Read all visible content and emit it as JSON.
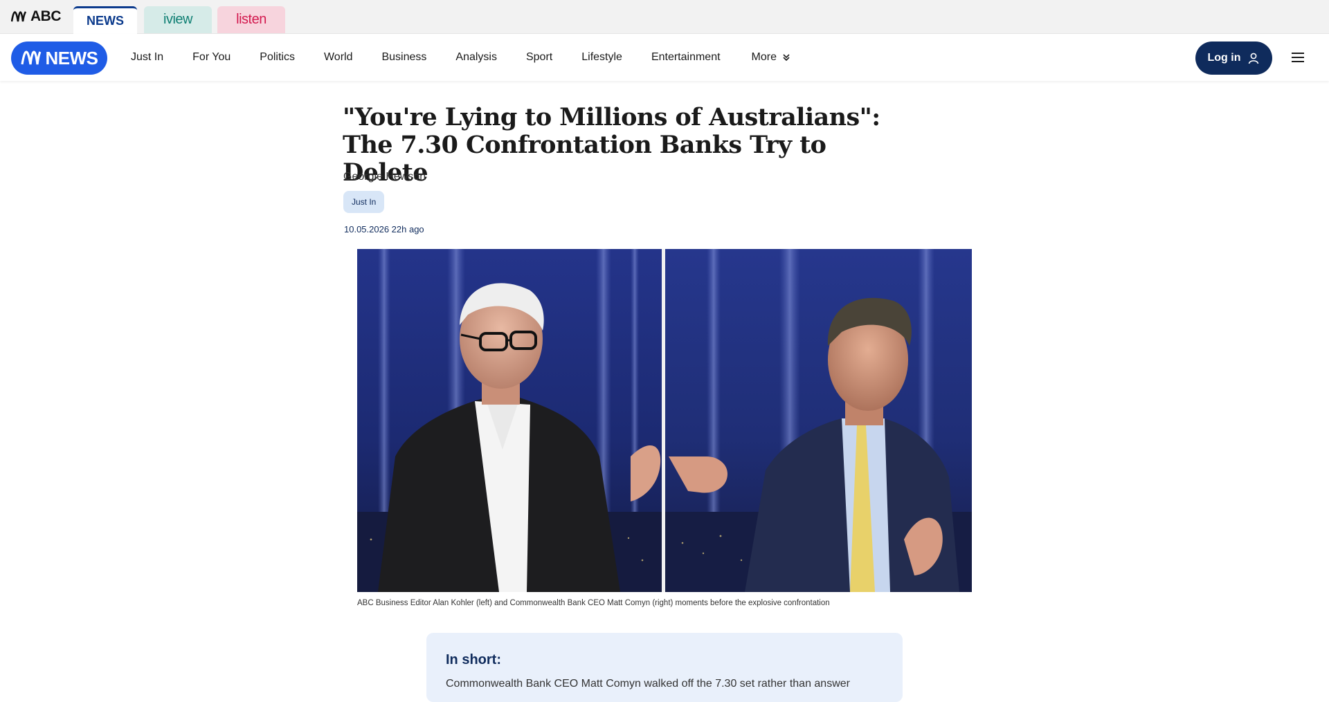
{
  "network_bar": {
    "logo_text": "ABC",
    "tabs": [
      {
        "label": "NEWS",
        "active": true
      },
      {
        "label": "iview",
        "active": false
      },
      {
        "label": "listen",
        "active": false
      }
    ]
  },
  "nav": {
    "logo_text": "NEWS",
    "links": [
      "Just In",
      "For You",
      "Politics",
      "World",
      "Business",
      "Analysis",
      "Sport",
      "Lifestyle",
      "Entertainment"
    ],
    "more_label": "More",
    "login_label": "Log in"
  },
  "article": {
    "title": "\"You're Lying to Millions of Australians\": The 7.30 Confrontation Banks Try to Delete",
    "author": "Georgie Hewson",
    "tag": "Just In",
    "timestamp": "10.05.2026 22h ago",
    "image_caption": "ABC Business Editor Alan Kohler (left) and Commonwealth Bank CEO Matt Comyn (right) moments before the explosive confrontation",
    "in_short": {
      "heading": "In short:",
      "text": "Commonwealth Bank CEO Matt Comyn walked off the 7.30 set rather than answer"
    }
  },
  "colors": {
    "abc_blue": "#1f5ce6",
    "navy": "#0f2b5c",
    "iview_bg": "#d6ebe8",
    "listen_bg": "#f7d4dd",
    "in_short_bg": "#e9f0fb"
  }
}
